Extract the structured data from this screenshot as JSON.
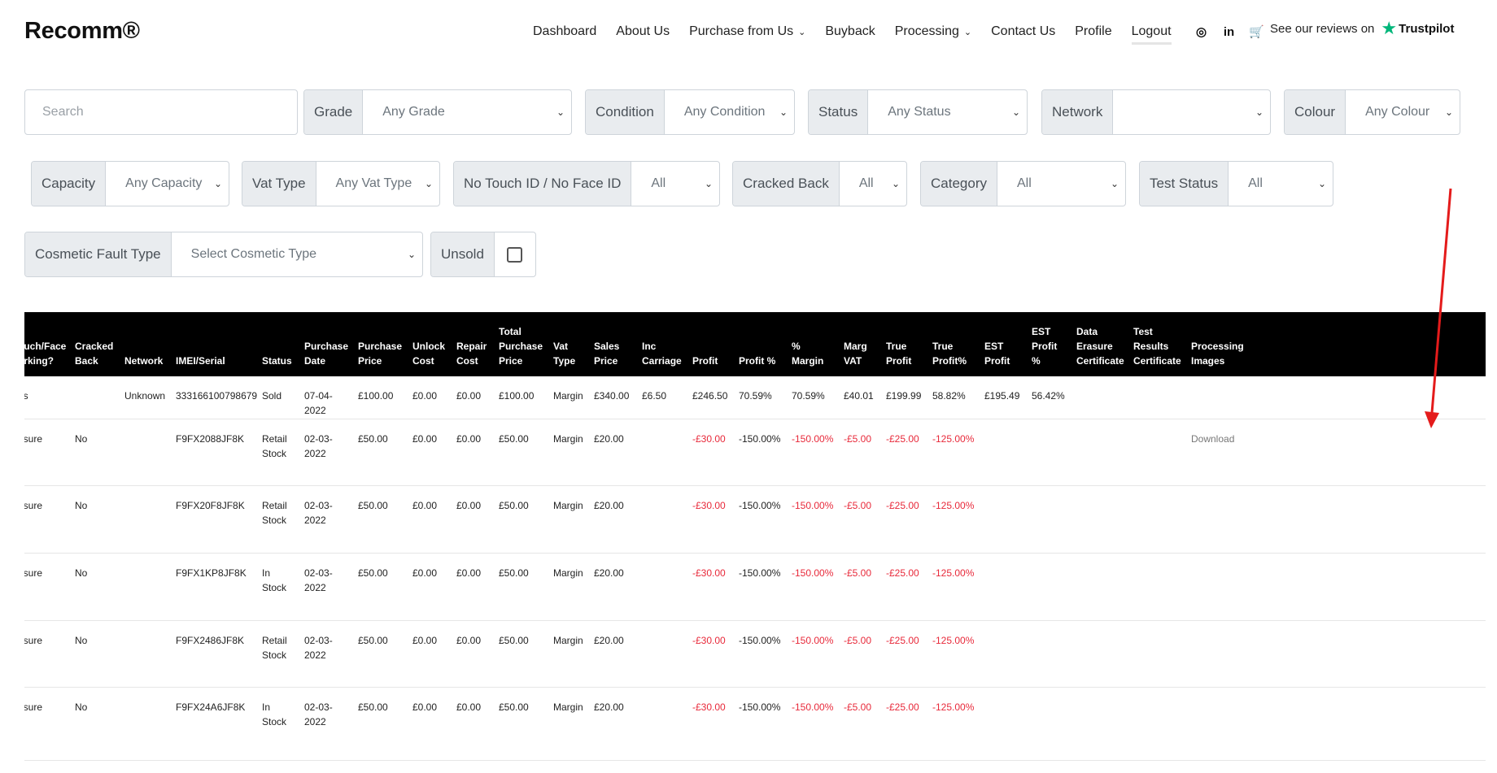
{
  "brand": "Recomm®",
  "nav": [
    {
      "label": "Dashboard",
      "name": "nav-dashboard"
    },
    {
      "label": "About Us",
      "name": "nav-about-us"
    },
    {
      "label": "Purchase from Us",
      "name": "nav-purchase",
      "dropdown": true
    },
    {
      "label": "Buyback",
      "name": "nav-buyback"
    },
    {
      "label": "Processing",
      "name": "nav-processing",
      "dropdown": true
    },
    {
      "label": "Contact Us",
      "name": "nav-contact-us"
    },
    {
      "label": "Profile",
      "name": "nav-profile"
    },
    {
      "label": "Logout",
      "name": "nav-logout",
      "active": true
    }
  ],
  "icons": [
    "whatsapp-icon",
    "linkedin-icon",
    "cart-icon"
  ],
  "trustpilot": {
    "text": "See our reviews on",
    "brand": "Trustpilot"
  },
  "search": {
    "placeholder": "Search"
  },
  "filters": {
    "grade": {
      "label": "Grade",
      "value": "Any Grade"
    },
    "condition": {
      "label": "Condition",
      "value": "Any Condition"
    },
    "status": {
      "label": "Status",
      "value": "Any Status"
    },
    "network": {
      "label": "Network",
      "value": ""
    },
    "colour": {
      "label": "Colour",
      "value": "Any Colour"
    },
    "capacity": {
      "label": "Capacity",
      "value": "Any Capacity"
    },
    "vat_type": {
      "label": "Vat Type",
      "value": "Any Vat Type"
    },
    "no_touch": {
      "label": "No Touch ID / No Face ID",
      "value": "All"
    },
    "cracked_back": {
      "label": "Cracked Back",
      "value": "All"
    },
    "category": {
      "label": "Category",
      "value": "All"
    },
    "test_status": {
      "label": "Test Status",
      "value": "All"
    },
    "cosmetic": {
      "label": "Cosmetic Fault Type",
      "value": "Select Cosmetic Type"
    },
    "unsold": {
      "label": "Unsold",
      "checked": false
    }
  },
  "table": {
    "columns": [
      [
        "ouch/Face",
        "orking?"
      ],
      [
        "Cracked",
        "Back"
      ],
      [
        "Network"
      ],
      [
        "IMEI/Serial"
      ],
      [
        "Status"
      ],
      [
        "Purchase",
        "Date"
      ],
      [
        "Purchase",
        "Price"
      ],
      [
        "Unlock",
        "Cost"
      ],
      [
        "Repair",
        "Cost"
      ],
      [
        "Total",
        "Purchase",
        "Price"
      ],
      [
        "Vat",
        "Type"
      ],
      [
        "Sales",
        "Price"
      ],
      [
        "Inc",
        "Carriage"
      ],
      [
        "Profit"
      ],
      [
        "Profit %"
      ],
      [
        "%",
        "Margin"
      ],
      [
        "Marg",
        "VAT"
      ],
      [
        "True",
        "Profit"
      ],
      [
        "True",
        "Profit%"
      ],
      [
        "EST",
        "Profit"
      ],
      [
        "EST",
        "Profit",
        "%"
      ],
      [
        "Data",
        "Erasure",
        "Certificate"
      ],
      [
        "Test",
        "Results",
        "Certificate"
      ],
      [
        "Processing",
        "Images"
      ]
    ],
    "rows": [
      [
        "es",
        "",
        "Unknown",
        "333166100798679",
        "Sold",
        "07-04-\n2022",
        "£100.00",
        "£0.00",
        "£0.00",
        "£100.00",
        "Margin",
        "£340.00",
        "£6.50",
        "£246.50",
        "70.59%",
        "70.59%",
        "£40.01",
        "£199.99",
        "58.82%",
        "£195.49",
        "56.42%",
        "",
        "",
        ""
      ],
      [
        "nsure",
        "No",
        "",
        "F9FX2088JF8K",
        "Retail\nStock",
        "02-03-\n2022",
        "£50.00",
        "£0.00",
        "£0.00",
        "£50.00",
        "Margin",
        "£20.00",
        "",
        "-£30.00",
        "-150.00%",
        "-150.00%",
        "-£5.00",
        "-£25.00",
        "-125.00%",
        "",
        "",
        "",
        "",
        "Download"
      ],
      [
        "nsure",
        "No",
        "",
        "F9FX20F8JF8K",
        "Retail\nStock",
        "02-03-\n2022",
        "£50.00",
        "£0.00",
        "£0.00",
        "£50.00",
        "Margin",
        "£20.00",
        "",
        "-£30.00",
        "-150.00%",
        "-150.00%",
        "-£5.00",
        "-£25.00",
        "-125.00%",
        "",
        "",
        "",
        "",
        ""
      ],
      [
        "nsure",
        "No",
        "",
        "F9FX1KP8JF8K",
        "In\nStock",
        "02-03-\n2022",
        "£50.00",
        "£0.00",
        "£0.00",
        "£50.00",
        "Margin",
        "£20.00",
        "",
        "-£30.00",
        "-150.00%",
        "-150.00%",
        "-£5.00",
        "-£25.00",
        "-125.00%",
        "",
        "",
        "",
        "",
        ""
      ],
      [
        "nsure",
        "No",
        "",
        "F9FX2486JF8K",
        "Retail\nStock",
        "02-03-\n2022",
        "£50.00",
        "£0.00",
        "£0.00",
        "£50.00",
        "Margin",
        "£20.00",
        "",
        "-£30.00",
        "-150.00%",
        "-150.00%",
        "-£5.00",
        "-£25.00",
        "-125.00%",
        "",
        "",
        "",
        "",
        ""
      ],
      [
        "nsure",
        "No",
        "",
        "F9FX24A6JF8K",
        "In\nStock",
        "02-03-\n2022",
        "£50.00",
        "£0.00",
        "£0.00",
        "£50.00",
        "Margin",
        "£20.00",
        "",
        "-£30.00",
        "-150.00%",
        "-150.00%",
        "-£5.00",
        "-£25.00",
        "-125.00%",
        "",
        "",
        "",
        "",
        ""
      ]
    ]
  },
  "colors": {
    "negative": "#e8293a",
    "annotation_arrow": "#e41b1b",
    "trustpilot_star": "#00b67a"
  }
}
